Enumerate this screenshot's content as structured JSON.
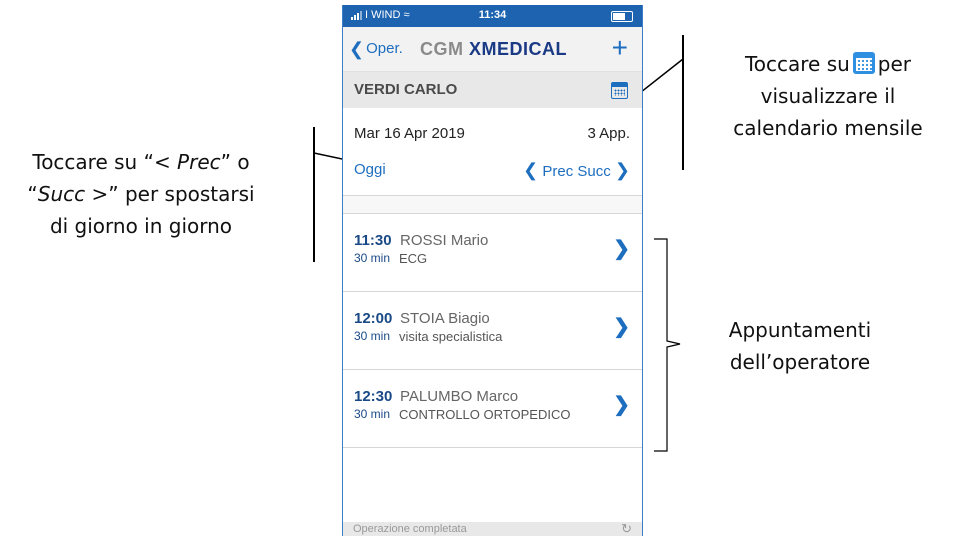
{
  "annotations": {
    "left": {
      "line1_a": "Toccare su “",
      "line1_b": "< Prec",
      "line1_c": "” o",
      "line2_a": "“",
      "line2_b": "Succ >",
      "line2_c": "” per spostarsi",
      "line3": "di giorno in giorno"
    },
    "right_top": {
      "line1_a": "Toccare su",
      "line1_b": "per",
      "line2": "visualizzare il",
      "line3": "calendario mensile"
    },
    "right_mid": {
      "line1": "Appuntamenti",
      "line2": "dell’operatore"
    }
  },
  "statusbar": {
    "carrier": "I WIND",
    "time": "11:34"
  },
  "navbar": {
    "back_label": "Oper.",
    "brand_cgm": "CGM",
    "brand_xmedical": "XMEDICAL",
    "add_label": "+"
  },
  "operator": {
    "name": "VERDI CARLO"
  },
  "day": {
    "date": "Mar 16 Apr 2019",
    "count": "3 App.",
    "today_label": "Oggi",
    "prev_label": "Prec",
    "next_label": "Succ"
  },
  "appointments": [
    {
      "time": "11:30",
      "patient": "ROSSI Mario",
      "duration": "30 min",
      "type": "ECG"
    },
    {
      "time": "12:00",
      "patient": "STOIA Biagio",
      "duration": "30 min",
      "type": "visita specialistica"
    },
    {
      "time": "12:30",
      "patient": "PALUMBO Marco",
      "duration": "30 min",
      "type": "CONTROLLO ORTOPEDICO"
    }
  ],
  "footer": {
    "message": "Operazione completata"
  },
  "colors": {
    "accent": "#1e6ec0",
    "statusbar": "#1e63b0",
    "brand_dark": "#1a3a86"
  },
  "icons": [
    "back-chevron-icon",
    "add-icon",
    "calendar-icon",
    "prev-chevron-icon",
    "next-chevron-icon",
    "disclosure-arrow-icon",
    "refresh-icon"
  ]
}
